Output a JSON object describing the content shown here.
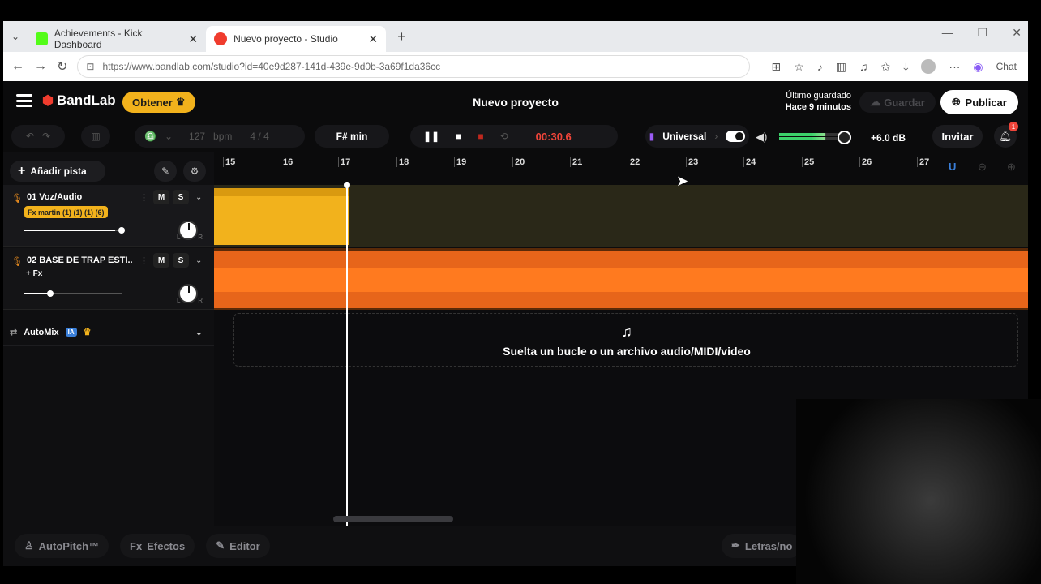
{
  "browser": {
    "tabs": [
      {
        "label": "Achievements - Kick Dashboard",
        "active": false,
        "icon": "kick-icon",
        "color": "#53fc18"
      },
      {
        "label": "Nuevo proyecto - Studio",
        "active": true,
        "icon": "bandlab-icon",
        "color": "#f03c2e"
      }
    ],
    "url": "https://www.bandlab.com/studio?id=40e9d287-141d-439e-9d0b-3a69f1da36cc",
    "chat_label": "Chat"
  },
  "app": {
    "brand": "BandLab",
    "obtener": "Obtener",
    "project_title": "Nuevo proyecto",
    "last_saved_label": "Último guardado",
    "last_saved_time": "Hace 9 minutos",
    "save_button": "Guardar",
    "publish_button": "Publicar"
  },
  "toolbar": {
    "bpm": "127",
    "bpm_unit": "bpm",
    "time_sig": "4 / 4",
    "key": "F# min",
    "time": "00:30.6",
    "preset": "Universal",
    "volume": "+6.0 dB",
    "invite": "Invitar",
    "notifications": "1"
  },
  "tracks_panel": {
    "add_track": "Añadir pista",
    "tracks": [
      {
        "name": "01 Voz/Audio",
        "fx": "Fx martin (1) (1) (1) (6)",
        "mute": "M",
        "solo": "S",
        "volume": 0.93
      },
      {
        "name": "02 BASE DE TRAP ESTI...",
        "fx": "+ Fx",
        "mute": "M",
        "solo": "S",
        "volume": 0.25
      }
    ],
    "automix": "AutoMix",
    "automix_badge": "IA",
    "pan_left": "L",
    "pan_right": "R"
  },
  "timeline": {
    "ruler": [
      "15",
      "16",
      "17",
      "18",
      "19",
      "20",
      "21",
      "22",
      "23",
      "24",
      "25",
      "26",
      "27"
    ],
    "drop_text": "Suelta un bucle o un archivo audio/MIDI/video"
  },
  "bottom": {
    "autopitch": "AutoPitch™",
    "effects_prefix": "Fx",
    "effects": "Efectos",
    "editor": "Editor",
    "lyrics": "Letras/no"
  }
}
